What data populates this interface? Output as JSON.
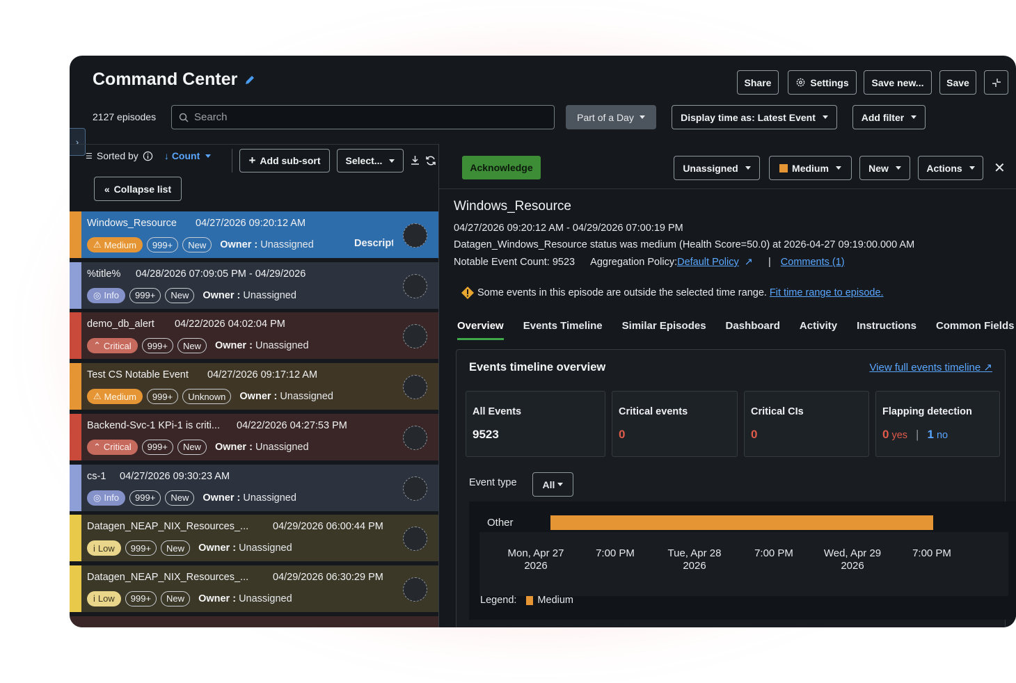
{
  "header": {
    "title": "Command Center",
    "episodes_count": "2127 episodes",
    "search_placeholder": "Search",
    "buttons": {
      "share": "Share",
      "settings": "Settings",
      "save_new": "Save new...",
      "save": "Save"
    },
    "part_of_day": "Part of a Day",
    "display_time": "Display time as: Latest Event",
    "add_filter": "Add filter"
  },
  "list": {
    "sorted_by": "Sorted by",
    "sort_field": "Count",
    "add_sub_sort": "Add sub-sort",
    "select": "Select...",
    "collapse": "Collapse list",
    "owner_label": "Owner :",
    "description_label": "Description",
    "items": [
      {
        "name": "Windows_Resource",
        "time": "04/27/2026 09:20:12 AM",
        "severity": "Medium",
        "count": "999+",
        "status": "New",
        "owner": "Unassigned"
      },
      {
        "name": "%title%",
        "time": "04/28/2026 07:09:05 PM - 04/29/2026",
        "severity": "Info",
        "count": "999+",
        "status": "New",
        "owner": "Unassigned"
      },
      {
        "name": "demo_db_alert",
        "time": "04/22/2026 04:02:04 PM",
        "severity": "Critical",
        "count": "999+",
        "status": "New",
        "owner": "Unassigned"
      },
      {
        "name": "Test CS Notable Event",
        "time": "04/27/2026 09:17:12 AM",
        "severity": "Medium",
        "count": "999+",
        "status": "Unknown",
        "owner": "Unassigned"
      },
      {
        "name": "Backend-Svc-1 KPi-1 is criti...",
        "time": "04/22/2026 04:27:53 PM",
        "severity": "Critical",
        "count": "999+",
        "status": "New",
        "owner": "Unassigned"
      },
      {
        "name": "cs-1",
        "time": "04/27/2026 09:30:23 AM",
        "severity": "Info",
        "count": "999+",
        "status": "New",
        "owner": "Unassigned"
      },
      {
        "name": "Datagen_NEAP_NIX_Resources_...",
        "time": "04/29/2026 06:00:44 PM",
        "severity": "Low",
        "count": "999+",
        "status": "New",
        "owner": "Unassigned"
      },
      {
        "name": "Datagen_NEAP_NIX_Resources_...",
        "time": "04/29/2026 06:30:29 PM",
        "severity": "Low",
        "count": "999+",
        "status": "New",
        "owner": "Unassigned"
      }
    ]
  },
  "detail": {
    "acknowledge": "Acknowledge",
    "owner_select": "Unassigned",
    "severity_select": "Medium",
    "status_select": "New",
    "actions": "Actions",
    "title": "Windows_Resource",
    "time_range": "04/27/2026 09:20:12 AM - 04/29/2026 07:00:19 PM",
    "description": "Datagen_Windows_Resource status was medium (Health Score=50.0) at 2026-04-27 09:19:00.000 AM",
    "notable_count": "Notable Event Count: 9523",
    "aggregation_label": "Aggregation Policy:",
    "aggregation_link": "Default Policy",
    "comments_link": "Comments (1)",
    "warning": "Some events in this episode are outside the selected time range.",
    "fit_link": "Fit time range to episode.",
    "tabs": [
      "Overview",
      "Events Timeline",
      "Similar Episodes",
      "Dashboard",
      "Activity",
      "Instructions",
      "Common Fields"
    ],
    "overview": {
      "title": "Events timeline overview",
      "view_full": "View full events timeline",
      "cards": {
        "all_events_label": "All Events",
        "all_events_value": "9523",
        "critical_events_label": "Critical events",
        "critical_events_value": "0",
        "critical_cis_label": "Critical CIs",
        "critical_cis_value": "0",
        "flapping_label": "Flapping detection",
        "flapping_yes_value": "0",
        "flapping_yes_label": "yes",
        "flapping_no_value": "1",
        "flapping_no_label": "no"
      },
      "event_type_label": "Event type",
      "event_type_value": "All",
      "timeline": {
        "row_label": "Other",
        "ticks": [
          {
            "l1": "Mon, Apr 27",
            "l2": "2026"
          },
          {
            "l1": "7:00 PM",
            "l2": ""
          },
          {
            "l1": "Tue, Apr 28",
            "l2": "2026"
          },
          {
            "l1": "7:00 PM",
            "l2": ""
          },
          {
            "l1": "Wed, Apr 29",
            "l2": "2026"
          },
          {
            "l1": "7:00 PM",
            "l2": ""
          }
        ],
        "legend_label": "Legend:",
        "legend_item": "Medium"
      }
    }
  },
  "colors": {
    "accent_blue": "#5aa6ff",
    "acknowledge_green": "#3c8d36",
    "medium": "#e69535",
    "critical": "#e05a4a",
    "low": "#e9c94a",
    "info": "#8d9fd6"
  }
}
